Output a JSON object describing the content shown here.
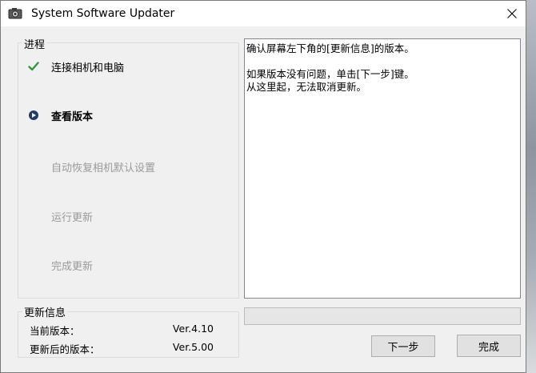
{
  "window": {
    "title": "System Software Updater",
    "icons": {
      "app": "camera-updater-icon",
      "close": "close-icon"
    }
  },
  "steps_group": {
    "label": "进程",
    "steps": [
      {
        "label": "连接相机和电脑",
        "state": "done",
        "icon": "checkmark-icon"
      },
      {
        "label": "查看版本",
        "state": "current",
        "icon": "current-step-icon"
      },
      {
        "label": "自动恢复相机默认设置",
        "state": "pending"
      },
      {
        "label": "运行更新",
        "state": "pending"
      },
      {
        "label": "完成更新",
        "state": "pending"
      }
    ]
  },
  "info_text": {
    "line1": "确认屏幕左下角的[更新信息]的版本。",
    "line2": "如果版本没有问题，单击[下一步]键。",
    "line3": "从这里起，无法取消更新。"
  },
  "update_group": {
    "label": "更新信息",
    "current_label": "当前版本：",
    "current_value": "Ver.4.10",
    "new_label": "更新后的版本：",
    "new_value": "Ver.5.00"
  },
  "progress": {
    "percent": 0
  },
  "buttons": {
    "next": "下一步",
    "finish": "完成"
  },
  "colors": {
    "done_check": "#2e9b3a",
    "current_icon": "#1f3a73",
    "pending_text": "#9a9a9a"
  }
}
